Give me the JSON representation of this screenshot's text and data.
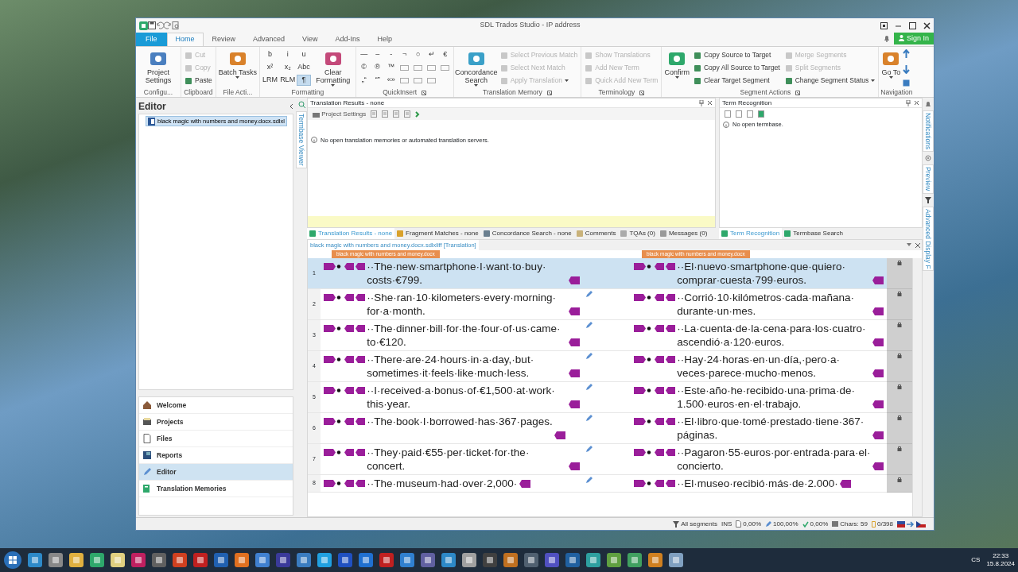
{
  "window": {
    "title": "SDL Trados Studio - IP address"
  },
  "ribbon": {
    "file_tab": "File",
    "sign_in": "Sign In",
    "tabs": [
      {
        "label": "Home",
        "selected": true
      },
      {
        "label": "Review",
        "selected": false
      },
      {
        "label": "Advanced",
        "selected": false
      },
      {
        "label": "View",
        "selected": false
      },
      {
        "label": "Add-Ins",
        "selected": false
      },
      {
        "label": "Help",
        "selected": false
      }
    ],
    "groups": [
      {
        "label": "Configu...",
        "launcher": false,
        "parts": [
          {
            "kind": "large",
            "label": "Project Settings",
            "dropdown": false
          }
        ]
      },
      {
        "label": "Clipboard",
        "launcher": false,
        "parts": [
          {
            "kind": "stack",
            "items": [
              {
                "label": "Cut",
                "disabled": true
              },
              {
                "label": "Copy",
                "disabled": true
              },
              {
                "label": "Paste",
                "disabled": false
              }
            ]
          }
        ]
      },
      {
        "label": "File Acti...",
        "launcher": false,
        "parts": [
          {
            "kind": "large",
            "label": "Batch Tasks",
            "dropdown": true
          }
        ]
      },
      {
        "label": "Formatting",
        "launcher": false,
        "parts": [
          {
            "kind": "glyphs",
            "items": [
              {
                "kind": "symbol",
                "label": "b",
                "selected": false
              },
              {
                "kind": "symbol",
                "label": "x²",
                "selected": false
              },
              {
                "kind": "symbol",
                "label": "LRM",
                "selected": false
              },
              {
                "kind": "symbol",
                "label": "i",
                "selected": false
              },
              {
                "kind": "symbol",
                "label": "x₂",
                "selected": false
              },
              {
                "kind": "symbol",
                "label": "RLM",
                "selected": false
              },
              {
                "kind": "symbol",
                "label": "u",
                "selected": false
              },
              {
                "kind": "symbol",
                "label": "Abc",
                "selected": false
              },
              {
                "kind": "symbol",
                "label": "¶",
                "selected": true
              }
            ]
          },
          {
            "kind": "large",
            "label": "Clear Formatting",
            "dropdown": true
          }
        ]
      },
      {
        "label": "QuickInsert",
        "launcher": true,
        "parts": [
          {
            "kind": "glyphs",
            "items": [
              {
                "kind": "symbol",
                "label": "—",
                "selected": false
              },
              {
                "kind": "symbol",
                "label": "©",
                "selected": false
              },
              {
                "kind": "symbol",
                "label": "„“",
                "selected": false
              },
              {
                "kind": "symbol",
                "label": "–",
                "selected": false
              },
              {
                "kind": "symbol",
                "label": "®",
                "selected": false
              },
              {
                "kind": "symbol",
                "label": "“”",
                "selected": false
              },
              {
                "kind": "symbol",
                "label": "-",
                "selected": false
              },
              {
                "kind": "symbol",
                "label": "™",
                "selected": false
              },
              {
                "kind": "symbol",
                "label": "«»",
                "selected": false
              },
              {
                "kind": "symbol",
                "label": "¬",
                "selected": false
              },
              {
                "kind": "box",
                "selected": false
              },
              {
                "kind": "box",
                "selected": false
              },
              {
                "kind": "symbol",
                "label": "○",
                "selected": false
              },
              {
                "kind": "box",
                "selected": false
              },
              {
                "kind": "box",
                "selected": false
              },
              {
                "kind": "symbol",
                "label": "↵",
                "selected": false
              },
              {
                "kind": "box",
                "selected": false
              },
              {
                "kind": "box",
                "selected": false
              },
              {
                "kind": "symbol",
                "label": "€",
                "selected": false
              },
              {
                "kind": "box",
                "selected": false
              }
            ]
          }
        ]
      },
      {
        "label": "Translation Memory",
        "launcher": true,
        "parts": [
          {
            "kind": "large",
            "label": "Concordance Search",
            "dropdown": true
          },
          {
            "kind": "stack",
            "items": [
              {
                "label": "Select Previous Match",
                "disabled": true
              },
              {
                "label": "Select Next Match",
                "disabled": true
              },
              {
                "label": "Apply Translation",
                "disabled": true,
                "dropdown": true
              }
            ]
          }
        ]
      },
      {
        "label": "Terminology",
        "launcher": true,
        "parts": [
          {
            "kind": "stack",
            "items": [
              {
                "label": "Show Translations",
                "disabled": true
              },
              {
                "label": "Add New Term",
                "disabled": true
              },
              {
                "label": "Quick Add New Term",
                "disabled": true
              }
            ]
          }
        ]
      },
      {
        "label": "Segment Actions",
        "launcher": true,
        "parts": [
          {
            "kind": "large",
            "label": "Confirm",
            "dropdown": true
          },
          {
            "kind": "stack",
            "items": [
              {
                "label": "Copy Source to Target",
                "disabled": false
              },
              {
                "label": "Copy All Source to Target",
                "disabled": false
              },
              {
                "label": "Clear Target Segment",
                "disabled": false
              }
            ]
          },
          {
            "kind": "stack",
            "items": [
              {
                "label": "Merge Segments",
                "disabled": true
              },
              {
                "label": "Split Segments",
                "disabled": true
              },
              {
                "label": "Change Segment Status",
                "disabled": false,
                "dropdown": true
              }
            ]
          }
        ]
      },
      {
        "label": "Navigation",
        "launcher": false,
        "parts": [
          {
            "kind": "large",
            "label": "Go To",
            "dropdown": true
          },
          {
            "kind": "arrows"
          }
        ]
      }
    ]
  },
  "navigation": {
    "title": "Editor",
    "files": [
      {
        "label": "black magic with numbers and money.docx.sdlxl",
        "selected": true
      }
    ],
    "views": [
      {
        "label": "Welcome",
        "selected": false
      },
      {
        "label": "Projects",
        "selected": false
      },
      {
        "label": "Files",
        "selected": false
      },
      {
        "label": "Reports",
        "selected": false
      },
      {
        "label": "Editor",
        "selected": true
      },
      {
        "label": "Translation Memories",
        "selected": false
      }
    ]
  },
  "left_strip": [
    "Termbase Viewer"
  ],
  "right_strip": [
    "Notifications",
    "Preview",
    "Advanced Display F"
  ],
  "translation_results": {
    "title": "Translation Results - none",
    "toolbar_label": "Project Settings",
    "message": "No open translation memories or automated translation servers."
  },
  "term_recognition": {
    "title": "Term Recognition",
    "message": "No open termbase."
  },
  "bottom_tabs": [
    {
      "label": "Translation Results - none",
      "selected": true
    },
    {
      "label": "Fragment Matches - none",
      "selected": false
    },
    {
      "label": "Concordance Search - none",
      "selected": false
    },
    {
      "label": "Comments",
      "selected": false
    },
    {
      "label": "TQAs (0)",
      "selected": false
    },
    {
      "label": "Messages (0)",
      "selected": false
    }
  ],
  "term_tabs": [
    {
      "label": "Term Recognition",
      "selected": true
    },
    {
      "label": "Termbase Search",
      "selected": false
    }
  ],
  "editor": {
    "document_tab": "black magic with numbers and money.docx.sdlxliff [Translation]",
    "source_file_label": "black magic with numbers and money.docx",
    "target_file_label": "black magic with numbers and money.docx",
    "rows": [
      {
        "number": "1",
        "selected": true,
        "draft": false,
        "source": "··The·new·smartphone·I·want·to·buy·costs·€799.",
        "target": "··El·nuevo·smartphone·que·quiero·comprar·cuesta·799·euros."
      },
      {
        "number": "2",
        "selected": false,
        "draft": true,
        "source": "··She·ran·10·kilometers·every·morning·for·a·month.",
        "target": "··Corrió·10·kilómetros·cada·mañana·durante·un·mes."
      },
      {
        "number": "3",
        "selected": false,
        "draft": true,
        "source": "··The·dinner·bill·for·the·four·of·us·came·to·€120.",
        "target": "··La·cuenta·de·la·cena·para·los·cuatro·ascendió·a·120·euros."
      },
      {
        "number": "4",
        "selected": false,
        "draft": true,
        "source": "··There·are·24·hours·in·a·day,·but·sometimes·it·feels·like·much·less.",
        "target": "··Hay·24·horas·en·un·día,·pero·a·veces·parece·mucho·menos."
      },
      {
        "number": "5",
        "selected": false,
        "draft": true,
        "source": "··I·received·a·bonus·of·€1,500·at·work·this·year.",
        "target": "··Este·año·he·recibido·una·prima·de·1.500·euros·en·el·trabajo."
      },
      {
        "number": "6",
        "selected": false,
        "draft": true,
        "source": "··The·book·I·borrowed·has·367·pages.",
        "target": "··El·libro·que·tomé·prestado·tiene·367·páginas."
      },
      {
        "number": "7",
        "selected": false,
        "draft": true,
        "source": "··They·paid·€55·per·ticket·for·the·concert.",
        "target": "··Pagaron·55·euros·por·entrada·para·el·concierto."
      },
      {
        "number": "8",
        "selected": false,
        "draft": true,
        "source": "··The·museum·had·over·2,000·",
        "target": "··El·museo·recibió·más·de·2.000·"
      }
    ]
  },
  "status_bar": {
    "filter": "All segments",
    "mode": "INS",
    "values": [
      "0,00%",
      "100,00%",
      "0,00%"
    ],
    "chars": "Chars: 59",
    "count": "0/398"
  },
  "taskbar": {
    "language": "CS",
    "time": "22:33",
    "date": "15.8.2024"
  }
}
